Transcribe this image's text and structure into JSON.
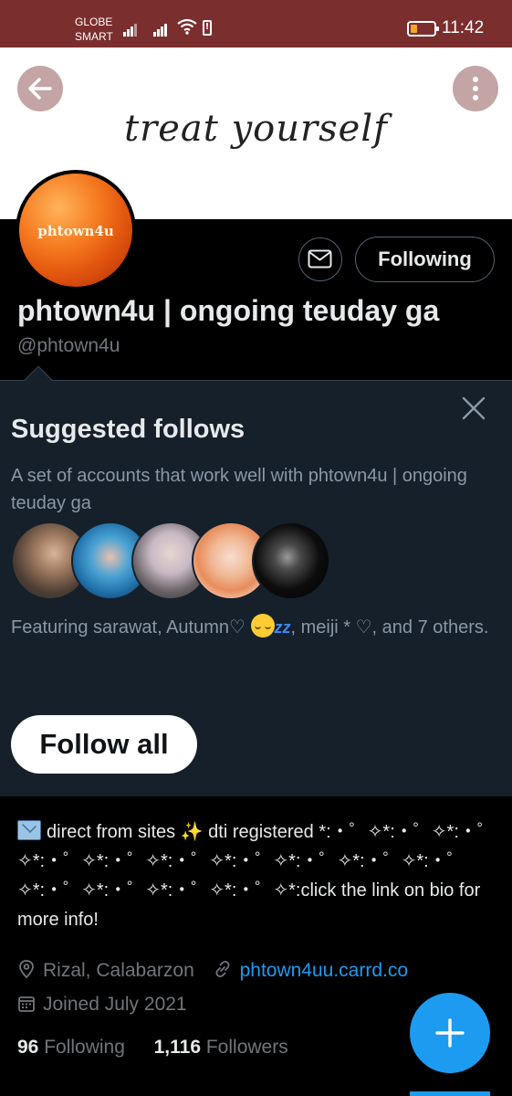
{
  "status_bar": {
    "carrier_line1": "GLOBE",
    "carrier_line2": "SMART",
    "time": "11:42",
    "battery_color": "#f5a623",
    "background": "#7b2e2e"
  },
  "header": {
    "banner_text": "treat yourself",
    "back_icon": "arrow-left-icon",
    "more_icon": "more-vertical-icon"
  },
  "profile": {
    "avatar_text": "phtown4u",
    "display_name": "phtown4u | ongoing teuday ga",
    "handle": "@phtown4u",
    "following_label": "Following",
    "dm_icon": "envelope-icon"
  },
  "suggested": {
    "title": "Suggested follows",
    "description": "A set of accounts that work well with phtown4u | ongoing teuday ga",
    "featuring_prefix": "Featuring sarawat, Autumn♡ ",
    "featuring_suffix": ", meiji * ♡, and 7 others.",
    "follow_all_label": "Follow all",
    "close_icon": "close-icon"
  },
  "bio": {
    "text_part1": "direct from sites ",
    "text_part2": " dti registered *:・゜✧*:・゜✧*:・゜✧*:・゜✧*:・゜✧*:・゜✧*:・゜✧*:・゜✧*:・゜✧*:・゜✧*:・゜✧*:・゜✧*:・゜✧*:・゜✧*:click the link on bio for more info!",
    "sparkles": "✨"
  },
  "meta": {
    "location": "Rizal, Calabarzon",
    "website": "phtown4uu.carrd.co",
    "joined": "Joined July 2021"
  },
  "counts": {
    "following_count": "96",
    "following_label": "Following",
    "followers_count": "1,116",
    "followers_label": "Followers"
  },
  "fab": {
    "icon": "plus-icon",
    "color": "#1d9bf0"
  }
}
